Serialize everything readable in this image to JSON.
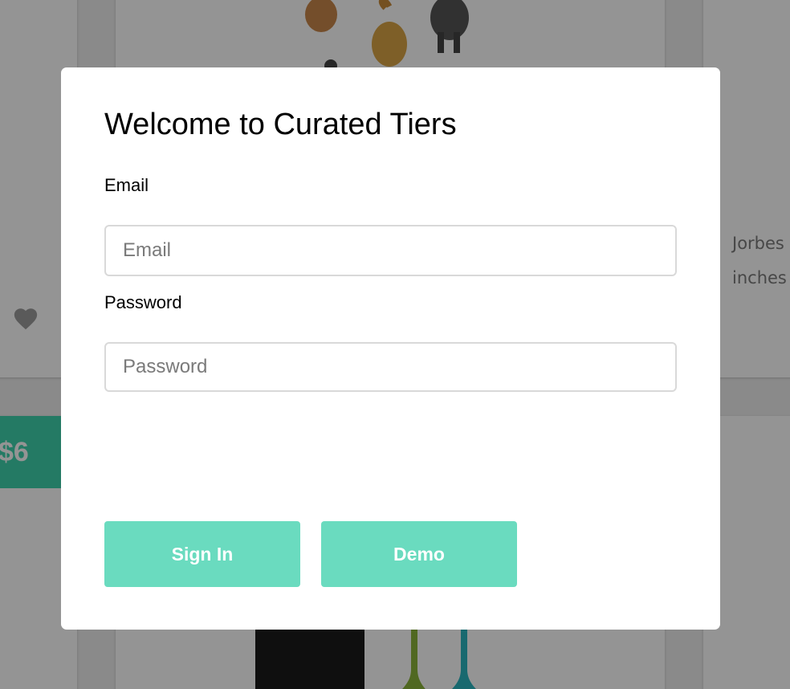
{
  "background": {
    "price_tag": "$6",
    "description_lines": [
      "Jorbes",
      "inches"
    ]
  },
  "modal": {
    "title": "Welcome to Curated Tiers",
    "email_label": "Email",
    "email_placeholder": "Email",
    "email_value": "",
    "password_label": "Password",
    "password_placeholder": "Password",
    "password_value": "",
    "signin_label": "Sign In",
    "demo_label": "Demo"
  },
  "colors": {
    "accent": "#6adbbf",
    "price_tag": "#3fd3ad",
    "overlay": "rgba(0,0,0,0.42)"
  },
  "icons": {
    "favorite": "heart-icon"
  }
}
